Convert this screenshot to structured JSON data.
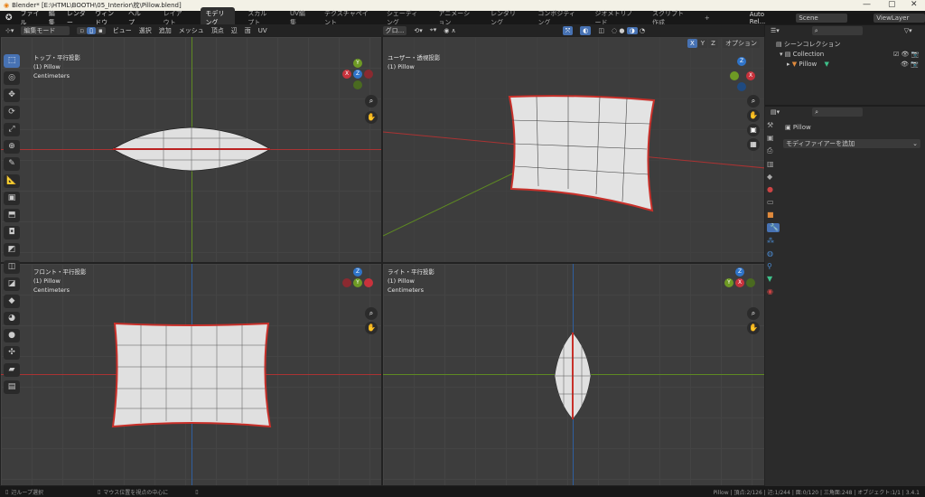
{
  "window": {
    "title": "Blender* [E:\\HTML\\BOOTH\\05_Interior\\枕\\Pillow.blend]",
    "min": "—",
    "max": "▢",
    "close": "✕"
  },
  "menu": [
    "ファイル",
    "編集",
    "レンダー",
    "ウィンドウ",
    "ヘルプ"
  ],
  "workspaces": [
    "レイアウト",
    "モデリング",
    "スカルプト",
    "UV編集",
    "テクスチャペイント",
    "シェーディング",
    "アニメーション",
    "レンダリング",
    "コンポジティング",
    "ジオメトリノード",
    "スクリプト作成",
    "+"
  ],
  "active_workspace": "モデリング",
  "scene": {
    "auto_label": "Auto Rel...",
    "scene": "Scene",
    "view_layer": "ViewLayer"
  },
  "header": {
    "mode": "編集モード",
    "menus": [
      "ビュー",
      "選択",
      "追加",
      "メッシュ",
      "頂点",
      "辺",
      "面",
      "UV"
    ],
    "orientation": "グロ...",
    "options": "オプション",
    "axes": [
      "X",
      "Y",
      "Z"
    ]
  },
  "viewports": [
    {
      "title": "トップ・平行投影",
      "object": "(1) Pillow",
      "units": "Centimeters"
    },
    {
      "title": "ユーザー・透視投影",
      "object": "(1) Pillow"
    },
    {
      "title": "フロント・平行投影",
      "object": "(1) Pillow",
      "units": "Centimeters"
    },
    {
      "title": "ライト・平行投影",
      "object": "(1) Pillow",
      "units": "Centimeters"
    }
  ],
  "outliner": {
    "scene_collection": "シーンコレクション",
    "collection": "Collection",
    "object": "Pillow"
  },
  "properties": {
    "object": "Pillow",
    "add_modifier": "モディファイアーを追加"
  },
  "status": {
    "left1": "辺ループ選択",
    "left2": "マウス位置を視点の中心に",
    "stats": "Pillow | 頂点:2/126 | 辺:1/244 | 面:0/120 | 三角面:248 | オブジェクト:1/1 | 3.4.1"
  },
  "colors": {
    "accent": "#4772b3",
    "x_axis": "#c8323c",
    "y_axis": "#6e9a24",
    "z_axis": "#2f74c9",
    "selection": "#c8302a"
  }
}
